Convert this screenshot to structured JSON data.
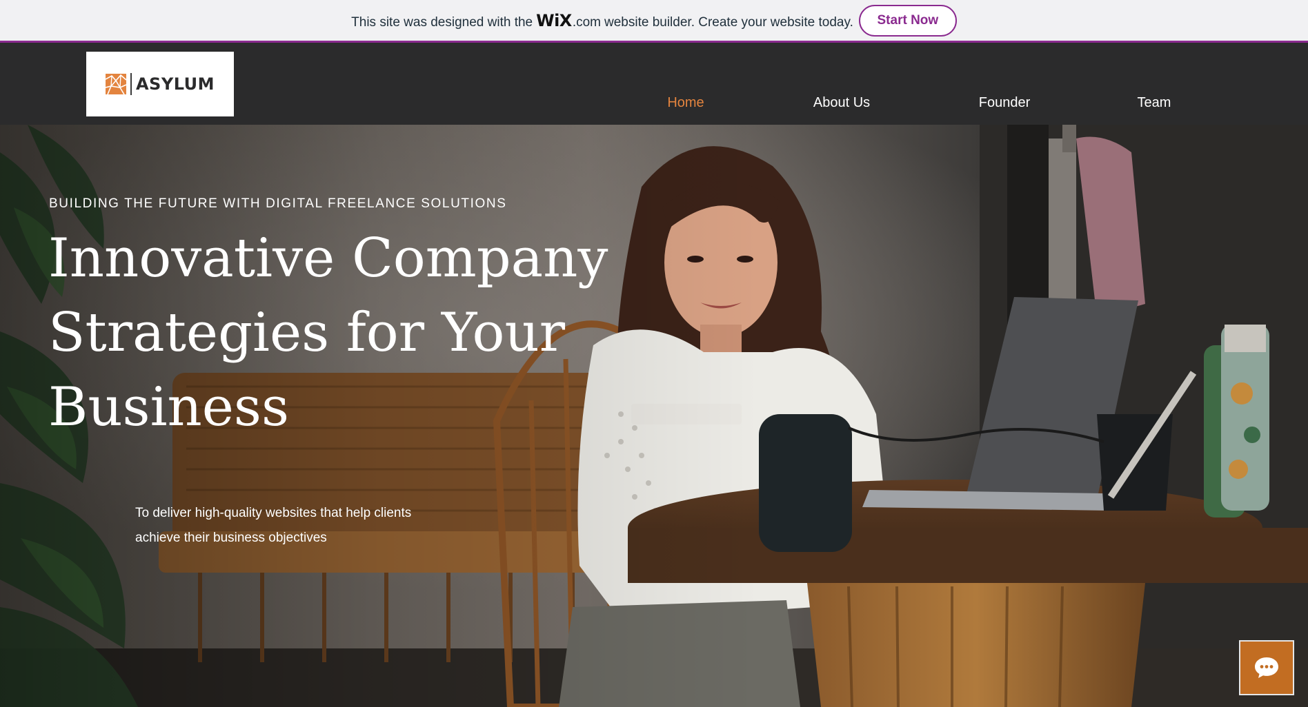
{
  "banner": {
    "text_before": "This site was designed with the",
    "wix_logo": "WiX",
    "wix_suffix": ".com",
    "text_after": "website builder. Create your website today.",
    "button_label": "Start Now",
    "accent_color": "#8a2a8f"
  },
  "header": {
    "logo_text": "ASYLUM",
    "logo_icon": "asylum-logo-mark-icon",
    "logo_color": "#e3843f",
    "nav": [
      {
        "label": "Home",
        "active": true
      },
      {
        "label": "About Us",
        "active": false
      },
      {
        "label": "Founder",
        "active": false
      },
      {
        "label": "Team",
        "active": false
      }
    ],
    "active_color": "#e3843f"
  },
  "hero": {
    "eyebrow": "BUILDING THE FUTURE WITH DIGITAL FREELANCE SOLUTIONS",
    "title": "Innovative Company Strategies for Your Business",
    "subtitle": "To deliver high-quality websites that help clients achieve their business objectives"
  },
  "chat": {
    "icon": "chat-bubble-icon",
    "color": "#c26d22"
  }
}
